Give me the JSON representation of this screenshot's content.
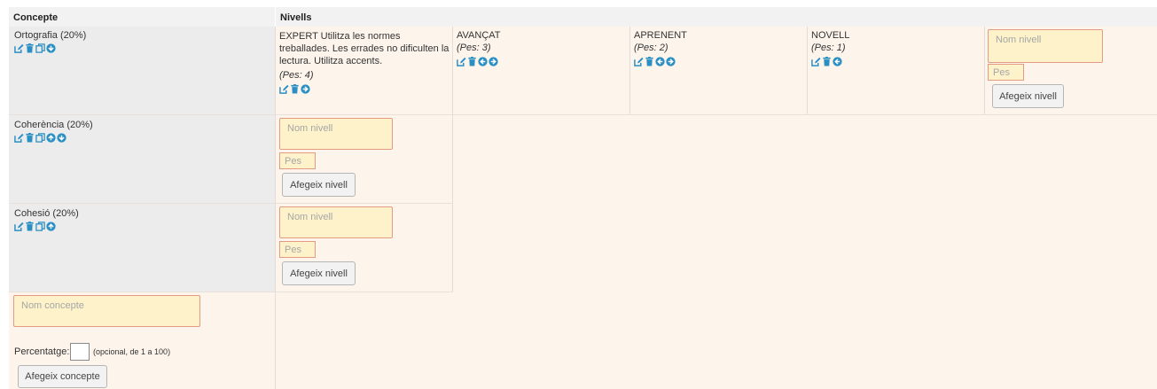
{
  "table": {
    "header_concept": "Concepte",
    "header_levels": "Nivells"
  },
  "concepts": [
    {
      "title": "Ortografia (20%)",
      "icons": [
        "edit-icon",
        "trash-icon",
        "copy-icon",
        "arrow-down-circle-icon"
      ],
      "levels": [
        {
          "name": "EXPERT Utilitza les normes treballades. Les errades no dificulten la lectura. Utilitza accents.",
          "weight": "(Pes: 4)",
          "icons": [
            "edit-icon",
            "trash-icon",
            "arrow-right-circle-icon"
          ]
        },
        {
          "name": "AVANÇAT",
          "weight": "(Pes: 3)",
          "icons": [
            "edit-icon",
            "trash-icon",
            "arrow-left-circle-icon",
            "arrow-right-circle-icon"
          ]
        },
        {
          "name": "APRENENT",
          "weight": "(Pes: 2)",
          "icons": [
            "edit-icon",
            "trash-icon",
            "arrow-left-circle-icon",
            "arrow-right-circle-icon"
          ]
        },
        {
          "name": "NOVELL",
          "weight": "(Pes: 1)",
          "icons": [
            "edit-icon",
            "trash-icon",
            "arrow-left-circle-icon"
          ]
        }
      ]
    },
    {
      "title": "Coherència (20%)",
      "icons": [
        "edit-icon",
        "trash-icon",
        "copy-icon",
        "arrow-up-circle-icon",
        "arrow-down-circle-icon"
      ]
    },
    {
      "title": "Cohesió (20%)",
      "icons": [
        "edit-icon",
        "trash-icon",
        "copy-icon",
        "arrow-up-circle-icon"
      ]
    }
  ],
  "level_form": {
    "name_placeholder": "Nom nivell",
    "weight_placeholder": "Pes",
    "add_button": "Afegeix nivell"
  },
  "concept_form": {
    "name_placeholder": "Nom concepte",
    "percent_label": "Percentatge:",
    "percent_hint": "(opcional, de 1 a 100)",
    "add_button": "Afegeix concepte"
  },
  "colors": {
    "icon_blue": "#2a8fc4",
    "input_bg": "#fdf2c9",
    "input_border": "#e59a82",
    "cream_bg": "#fdf4ec",
    "grey_bg": "#ececec"
  }
}
